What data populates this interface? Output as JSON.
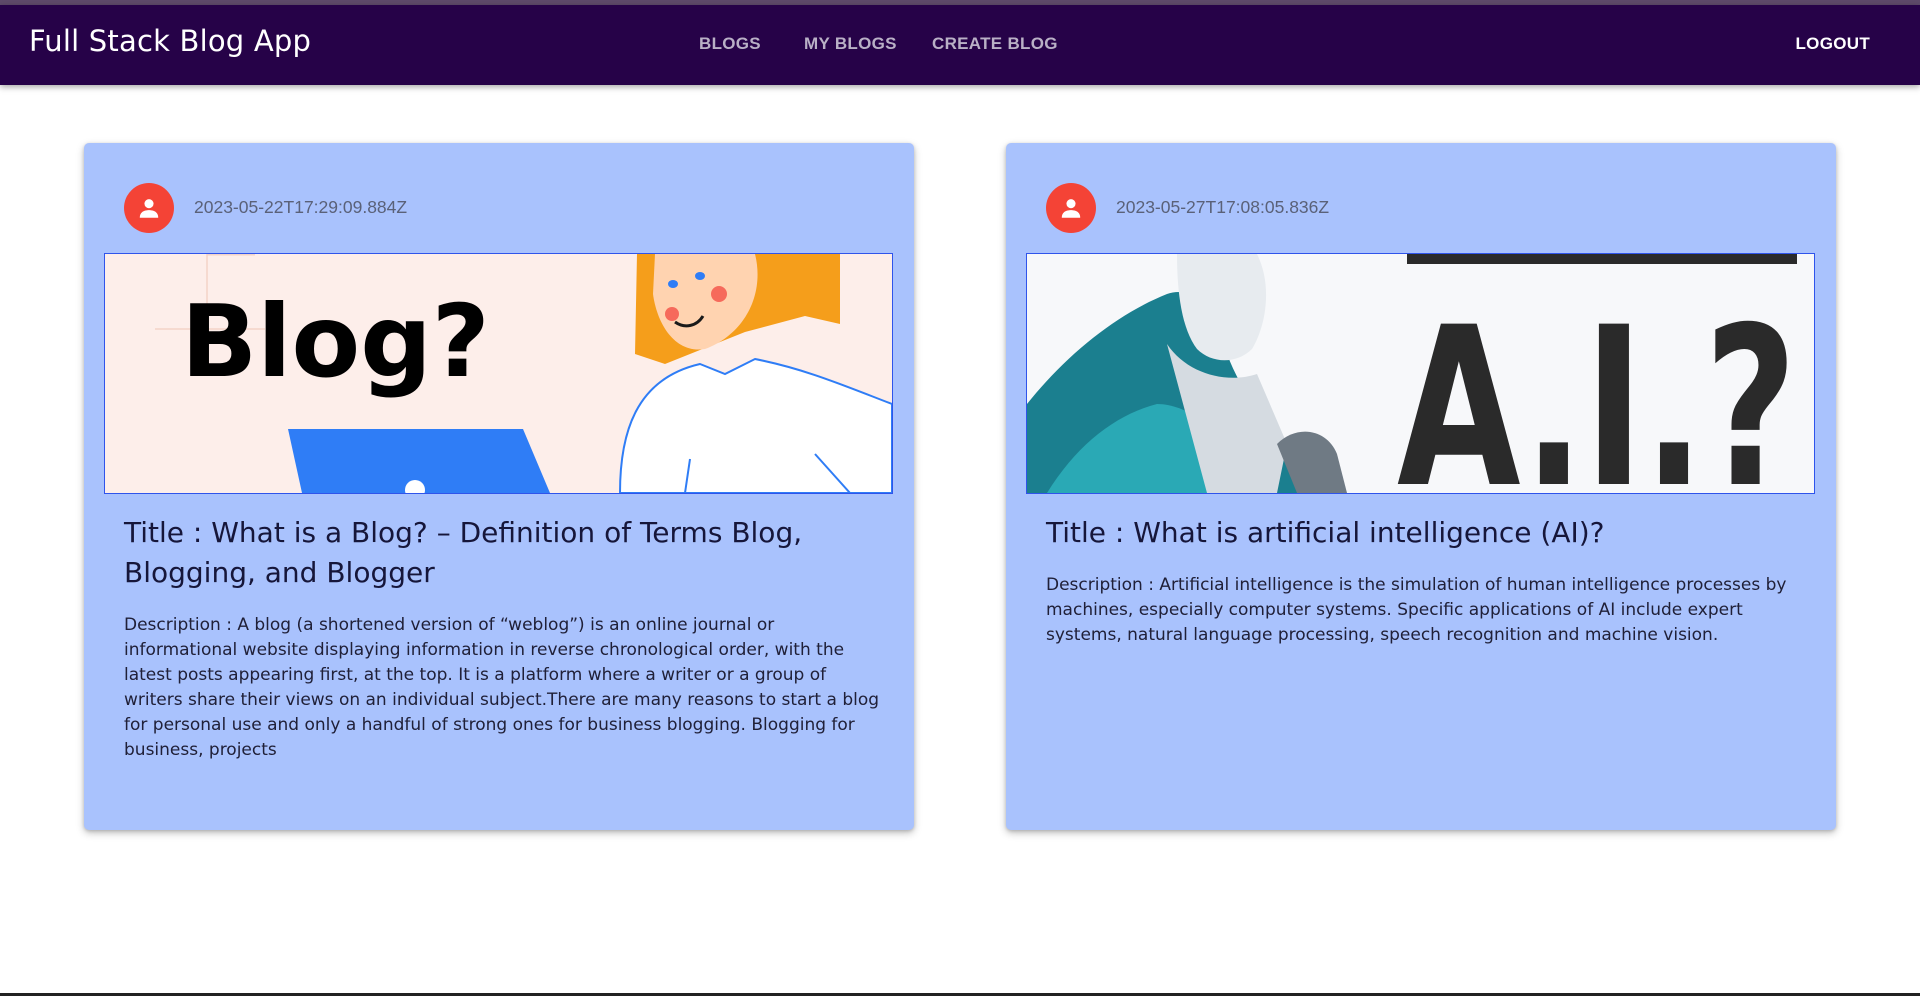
{
  "appbar": {
    "brand": "Full Stack Blog App",
    "nav": {
      "blogs": "BLOGS",
      "my_blogs": "MY BLOGS",
      "create_blog": "CREATE BLOG"
    },
    "logout": "LOGOUT",
    "colors": {
      "background": "#260248",
      "nav_text": "#b9b0c6",
      "brand_text": "#ffffff"
    }
  },
  "blogs": [
    {
      "date": "2023-05-22T17:29:09.884Z",
      "image_text": "Blog?",
      "title": "Title : What is a Blog? – Definition of Terms Blog, Blogging, and Blogger",
      "description": "Description : A blog (a shortened version of “weblog”) is an online journal or informational website displaying information in reverse chronological order, with the latest posts appearing first, at the top. It is a platform where a writer or a group of writers share their views on an individual subject.There are many reasons to start a blog for personal use and only a handful of strong ones for business blogging. Blogging for business, projects"
    },
    {
      "date": "2023-05-27T17:08:05.836Z",
      "image_text": "A.I.?",
      "title": "Title : What is artificial intelligence (AI)?",
      "description": "Description : Artificial intelligence is the simulation of human intelligence processes by machines, especially computer systems. Specific applications of AI include expert systems, natural language processing, speech recognition and machine vision."
    }
  ],
  "colors": {
    "card_background": "#a9c2fd",
    "avatar": "#f44336",
    "image_border": "#2f54eb"
  }
}
